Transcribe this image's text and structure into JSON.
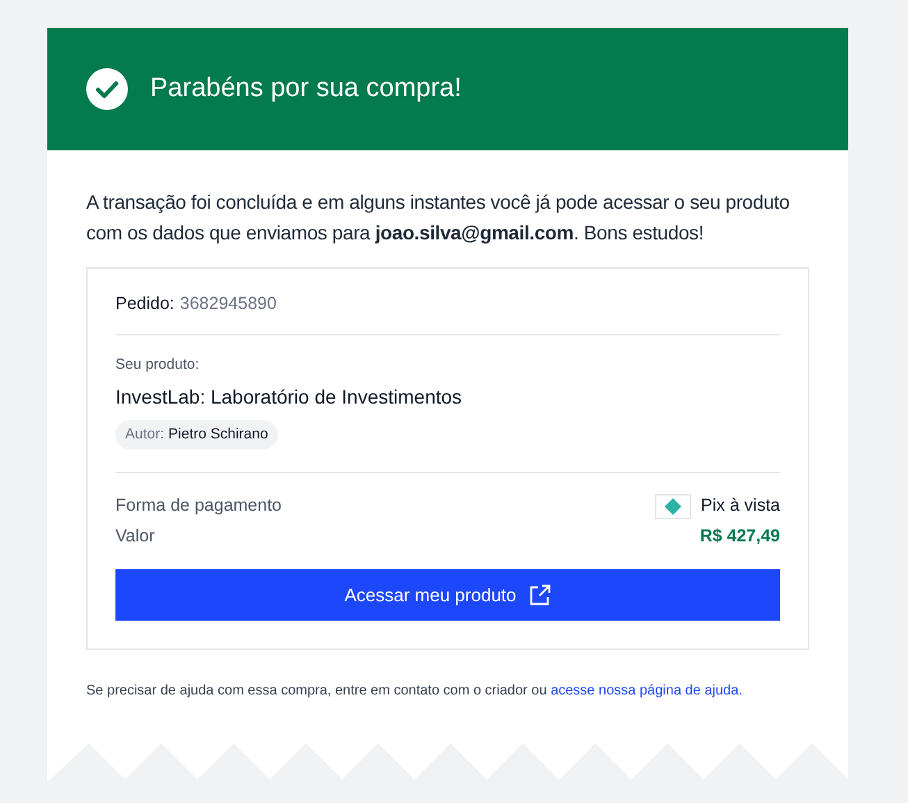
{
  "header": {
    "title": "Parabéns por sua compra!"
  },
  "intro": "A transação foi concluída e em alguns instantes você já pode acessar o seu produto com os dados que enviamos para **joao.silva@gmail.com**. Bons estudos!",
  "order": {
    "label": "Pedido:",
    "number": "3682945890"
  },
  "product": {
    "caption": "Seu produto:",
    "name": "InvestLab: Laboratório de Investimentos",
    "author_label": "Autor:",
    "author": "Pietro Schirano"
  },
  "payment": {
    "method_label": "Forma de pagamento",
    "method": "Pix à vista",
    "value_label": "Valor",
    "value": "R$ 427,49"
  },
  "button": {
    "label": "Acessar meu produto"
  },
  "help": {
    "text": "Se precisar de ajuda com essa compra, entre em contato com o criador ou ",
    "link": "acesse nossa página de ajuda."
  }
}
